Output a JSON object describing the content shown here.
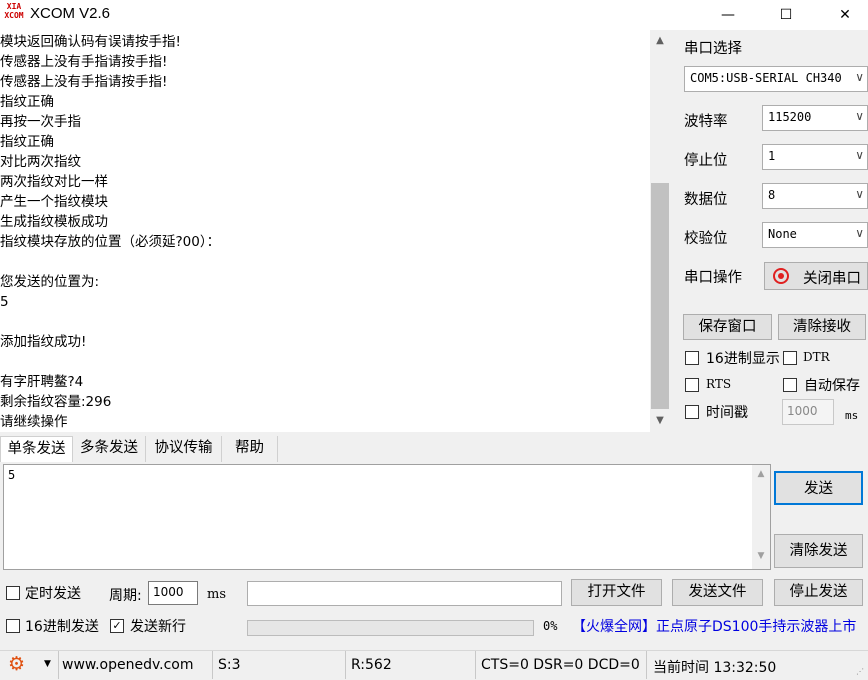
{
  "window": {
    "icon_text": "XIA\nXCOM",
    "title": "XCOM V2.6",
    "minimize": "—",
    "maximize": "☐",
    "close": "✕"
  },
  "receive": {
    "lines": [
      "模块返回确认码有误请按手指!",
      "传感器上没有手指请按手指!",
      "传感器上没有手指请按手指!",
      "指纹正确",
      "再按一次手指",
      "指纹正确",
      "对比两次指纹",
      "两次指纹对比一样",
      "产生一个指纹模块",
      "生成指纹模板成功",
      "指纹模块存放的位置（必须延?00）：",
      "",
      "您发送的位置为:",
      "5",
      "",
      "添加指纹成功!",
      "",
      "有字肝聘鳌?4",
      "剩余指纹容量:296",
      "请继续操作"
    ]
  },
  "right_panel": {
    "port_select_label": "串口选择",
    "port_value": "COM5:USB-SERIAL CH340",
    "baud_label": "波特率",
    "baud_value": "115200",
    "stop_label": "停止位",
    "stop_value": "1",
    "data_label": "数据位",
    "data_value": "8",
    "parity_label": "校验位",
    "parity_value": "None",
    "op_label": "串口操作",
    "close_port": "关闭串口",
    "save_window": "保存窗口",
    "clear_recv": "清除接收",
    "hex_display": "16进制显示",
    "dtr": "DTR",
    "rts": "RTS",
    "auto_save": "自动保存",
    "timestamp": "时间戳",
    "timestamp_value": "1000",
    "timestamp_unit": "ms"
  },
  "tabs": [
    "单条发送",
    "多条发送",
    "协议传输",
    "帮助"
  ],
  "send": {
    "text": "5",
    "send_button": "发送",
    "clear_send": "清除发送",
    "timed_send": "定时发送",
    "period_label": "周期:",
    "period_value": "1000",
    "period_unit": "ms",
    "open_file": "打开文件",
    "send_file": "发送文件",
    "stop_send": "停止发送",
    "hex_send": "16进制发送",
    "send_newline": "发送新行",
    "progress_percent": "0%",
    "promo": "【火爆全网】正点原子DS100手持示波器上市"
  },
  "statusbar": {
    "url": "www.openedv.com",
    "s": "S:3",
    "r": "R:562",
    "lines": "CTS=0 DSR=0 DCD=0",
    "time": "当前时间 13:32:50"
  },
  "colors": {
    "red_indicator": "#e02020",
    "link_blue": "#0000e0",
    "scroll_thumb": "#c1c1c1"
  }
}
